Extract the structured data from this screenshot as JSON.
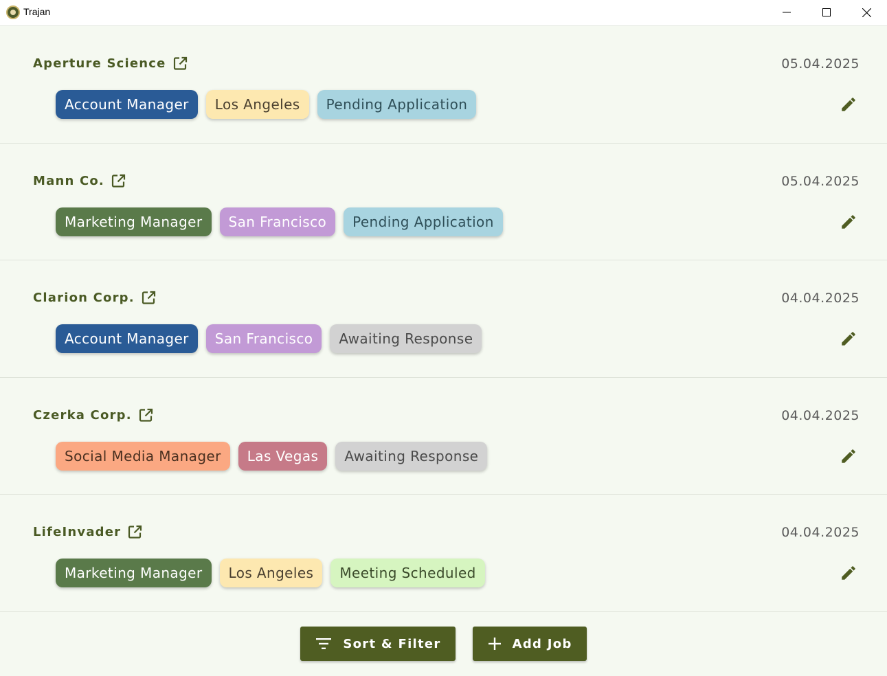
{
  "window": {
    "title": "Trajan",
    "controls": [
      "minimize-icon",
      "maximize-icon",
      "close-icon"
    ]
  },
  "colors": {
    "accent": "#4f5d22",
    "company_text": "#4a5a24",
    "background": "#f5f9f1"
  },
  "jobs": [
    {
      "company": "Aperture Science",
      "date": "05.04.2025",
      "tags": [
        {
          "label": "Account Manager",
          "bg": "#2a5b96",
          "fg": "#ffffff"
        },
        {
          "label": "Los Angeles",
          "bg": "#fde8b0",
          "fg": "#4a4030"
        },
        {
          "label": "Pending Application",
          "bg": "#a8d4e0",
          "fg": "#2f4f58"
        }
      ]
    },
    {
      "company": "Mann Co.",
      "date": "05.04.2025",
      "tags": [
        {
          "label": "Marketing Manager",
          "bg": "#5a7a4a",
          "fg": "#ffffff"
        },
        {
          "label": "San Francisco",
          "bg": "#c29ad6",
          "fg": "#ffffff"
        },
        {
          "label": "Pending Application",
          "bg": "#a8d4e0",
          "fg": "#2f4f58"
        }
      ]
    },
    {
      "company": "Clarion Corp.",
      "date": "04.04.2025",
      "tags": [
        {
          "label": "Account Manager",
          "bg": "#2a5b96",
          "fg": "#ffffff"
        },
        {
          "label": "San Francisco",
          "bg": "#c29ad6",
          "fg": "#ffffff"
        },
        {
          "label": "Awaiting Response",
          "bg": "#d2d2d2",
          "fg": "#4a4a4a"
        }
      ]
    },
    {
      "company": "Czerka Corp.",
      "date": "04.04.2025",
      "tags": [
        {
          "label": "Social Media Manager",
          "bg": "#fba882",
          "fg": "#4a3020"
        },
        {
          "label": "Las Vegas",
          "bg": "#c67a88",
          "fg": "#ffffff"
        },
        {
          "label": "Awaiting Response",
          "bg": "#d2d2d2",
          "fg": "#4a4a4a"
        }
      ]
    },
    {
      "company": "LifeInvader",
      "date": "04.04.2025",
      "tags": [
        {
          "label": "Marketing Manager",
          "bg": "#5a7a4a",
          "fg": "#ffffff"
        },
        {
          "label": "Los Angeles",
          "bg": "#fde8b0",
          "fg": "#4a4030"
        },
        {
          "label": "Meeting Scheduled",
          "bg": "#d6f5c0",
          "fg": "#3a4a2a"
        }
      ]
    }
  ],
  "actions": {
    "sort_filter_label": "Sort & Filter",
    "add_job_label": "Add Job"
  }
}
